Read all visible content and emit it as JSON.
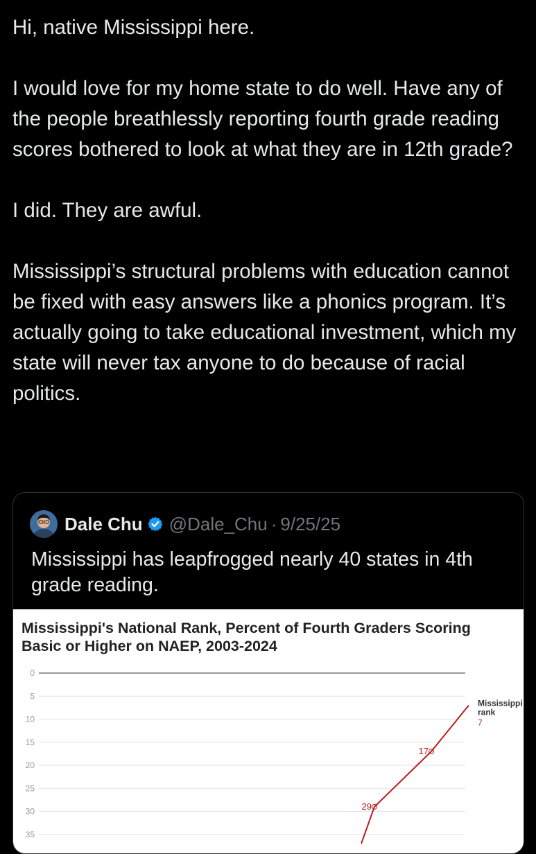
{
  "post": {
    "paragraphs": [
      "Hi, native Mississippi here.",
      "I would love for my home state to do well. Have any of the people breathlessly reporting fourth grade reading scores bothered to look at what they are in 12th grade?",
      "I did. They are awful.",
      "Mississippi’s structural problems with education cannot be fixed with easy answers like a phonics program. It’s actually going to take educational investment, which my state will never tax anyone to do because of racial politics."
    ]
  },
  "quoted_post": {
    "author_name": "Dale Chu",
    "author_handle": "@Dale_Chu",
    "separator": "·",
    "date": "9/25/25",
    "text": "Mississippi has leapfrogged nearly 40 states in 4th grade reading.",
    "avatar_icon": "profile-photo",
    "verified_icon": "verified-badge-icon",
    "verified_color": "#1d9bf0"
  },
  "chart_data": {
    "type": "line",
    "title": "Mississippi's National Rank, Percent of Fourth Graders Scoring Basic or Higher on NAEP, 2003-2024",
    "y_ticks": [
      "0",
      "5",
      "10",
      "15",
      "20",
      "25",
      "30",
      "35"
    ],
    "ylim": [
      0,
      35
    ],
    "y_inverted": true,
    "series": [
      {
        "name_lines": [
          "Mississippi",
          "rank"
        ],
        "color": "#b71c1c",
        "points": [
          {
            "y": 37,
            "label": ""
          },
          {
            "y": 29,
            "label": "29"
          },
          {
            "y": 17,
            "label": "17"
          },
          {
            "y": 7,
            "label": "7"
          }
        ]
      }
    ],
    "grid": true,
    "legend": "end-of-line"
  }
}
